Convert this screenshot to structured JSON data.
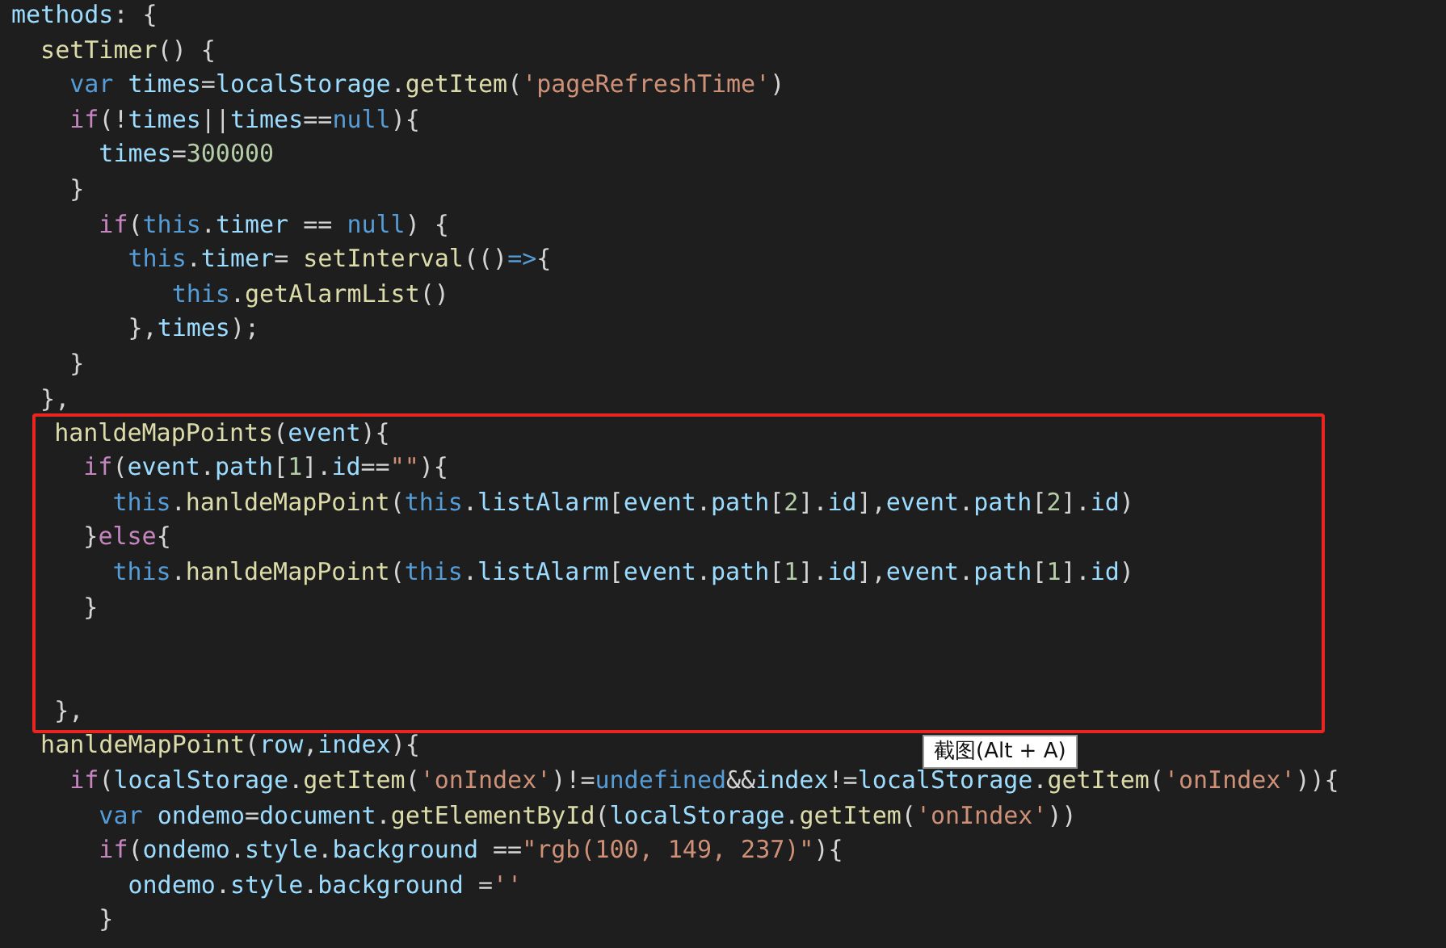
{
  "editor": {
    "sections": [
      {
        "boxed": false,
        "lines": [
          {
            "tokens": [
              {
                "text": "methods",
                "kind": "variable"
              },
              {
                "text": ": {",
                "kind": "plain"
              }
            ]
          },
          {
            "tokens": [
              {
                "text": "  setTimer",
                "kind": "function"
              },
              {
                "text": "() {",
                "kind": "plain"
              }
            ]
          },
          {
            "tokens": [
              {
                "text": "    var ",
                "kind": "keyword"
              },
              {
                "text": "times",
                "kind": "variable"
              },
              {
                "text": "=",
                "kind": "plain"
              },
              {
                "text": "localStorage",
                "kind": "variable"
              },
              {
                "text": ".",
                "kind": "plain"
              },
              {
                "text": "getItem",
                "kind": "function"
              },
              {
                "text": "(",
                "kind": "plain"
              },
              {
                "text": "'pageRefreshTime'",
                "kind": "string"
              },
              {
                "text": ")",
                "kind": "plain"
              }
            ]
          },
          {
            "tokens": [
              {
                "text": "    if",
                "kind": "control"
              },
              {
                "text": "(!",
                "kind": "plain"
              },
              {
                "text": "times",
                "kind": "variable"
              },
              {
                "text": "||",
                "kind": "plain"
              },
              {
                "text": "times",
                "kind": "variable"
              },
              {
                "text": "==",
                "kind": "plain"
              },
              {
                "text": "null",
                "kind": "keyword"
              },
              {
                "text": "){",
                "kind": "plain"
              }
            ]
          },
          {
            "tokens": [
              {
                "text": "      times",
                "kind": "variable"
              },
              {
                "text": "=",
                "kind": "plain"
              },
              {
                "text": "300000",
                "kind": "number"
              }
            ]
          },
          {
            "tokens": [
              {
                "text": "    }",
                "kind": "plain"
              }
            ]
          },
          {
            "tokens": [
              {
                "text": "      if",
                "kind": "control"
              },
              {
                "text": "(",
                "kind": "plain"
              },
              {
                "text": "this",
                "kind": "keyword"
              },
              {
                "text": ".",
                "kind": "plain"
              },
              {
                "text": "timer",
                "kind": "variable"
              },
              {
                "text": " == ",
                "kind": "plain"
              },
              {
                "text": "null",
                "kind": "keyword"
              },
              {
                "text": ") {",
                "kind": "plain"
              }
            ]
          },
          {
            "tokens": [
              {
                "text": "        this",
                "kind": "keyword"
              },
              {
                "text": ".",
                "kind": "plain"
              },
              {
                "text": "timer",
                "kind": "variable"
              },
              {
                "text": "= ",
                "kind": "plain"
              },
              {
                "text": "setInterval",
                "kind": "function"
              },
              {
                "text": "(()",
                "kind": "plain"
              },
              {
                "text": "=>",
                "kind": "keyword"
              },
              {
                "text": "{",
                "kind": "plain"
              }
            ]
          },
          {
            "tokens": [
              {
                "text": "           this",
                "kind": "keyword"
              },
              {
                "text": ".",
                "kind": "plain"
              },
              {
                "text": "getAlarmList",
                "kind": "function"
              },
              {
                "text": "()",
                "kind": "plain"
              }
            ]
          },
          {
            "tokens": [
              {
                "text": "        },",
                "kind": "plain"
              },
              {
                "text": "times",
                "kind": "variable"
              },
              {
                "text": ");",
                "kind": "plain"
              }
            ]
          },
          {
            "tokens": [
              {
                "text": "    }",
                "kind": "plain"
              }
            ]
          },
          {
            "tokens": [
              {
                "text": "  },",
                "kind": "plain"
              }
            ]
          }
        ]
      },
      {
        "boxed": true,
        "lines": [
          {
            "tokens": [
              {
                "text": "   hanldeMapPoints",
                "kind": "function"
              },
              {
                "text": "(",
                "kind": "plain"
              },
              {
                "text": "event",
                "kind": "variable"
              },
              {
                "text": "){",
                "kind": "plain"
              }
            ]
          },
          {
            "tokens": [
              {
                "text": "     if",
                "kind": "control"
              },
              {
                "text": "(",
                "kind": "plain"
              },
              {
                "text": "event",
                "kind": "variable"
              },
              {
                "text": ".",
                "kind": "plain"
              },
              {
                "text": "path",
                "kind": "variable"
              },
              {
                "text": "[",
                "kind": "plain"
              },
              {
                "text": "1",
                "kind": "number"
              },
              {
                "text": "].",
                "kind": "plain"
              },
              {
                "text": "id",
                "kind": "variable"
              },
              {
                "text": "==",
                "kind": "plain"
              },
              {
                "text": "\"\"",
                "kind": "string"
              },
              {
                "text": "){",
                "kind": "plain"
              }
            ]
          },
          {
            "tokens": [
              {
                "text": "       this",
                "kind": "keyword"
              },
              {
                "text": ".",
                "kind": "plain"
              },
              {
                "text": "hanldeMapPoint",
                "kind": "function"
              },
              {
                "text": "(",
                "kind": "plain"
              },
              {
                "text": "this",
                "kind": "keyword"
              },
              {
                "text": ".",
                "kind": "plain"
              },
              {
                "text": "listAlarm",
                "kind": "variable"
              },
              {
                "text": "[",
                "kind": "plain"
              },
              {
                "text": "event",
                "kind": "variable"
              },
              {
                "text": ".",
                "kind": "plain"
              },
              {
                "text": "path",
                "kind": "variable"
              },
              {
                "text": "[",
                "kind": "plain"
              },
              {
                "text": "2",
                "kind": "number"
              },
              {
                "text": "].",
                "kind": "plain"
              },
              {
                "text": "id",
                "kind": "variable"
              },
              {
                "text": "],",
                "kind": "plain"
              },
              {
                "text": "event",
                "kind": "variable"
              },
              {
                "text": ".",
                "kind": "plain"
              },
              {
                "text": "path",
                "kind": "variable"
              },
              {
                "text": "[",
                "kind": "plain"
              },
              {
                "text": "2",
                "kind": "number"
              },
              {
                "text": "].",
                "kind": "plain"
              },
              {
                "text": "id",
                "kind": "variable"
              },
              {
                "text": ")",
                "kind": "plain"
              }
            ]
          },
          {
            "tokens": [
              {
                "text": "     }",
                "kind": "plain"
              },
              {
                "text": "else",
                "kind": "control"
              },
              {
                "text": "{",
                "kind": "plain"
              }
            ]
          },
          {
            "tokens": [
              {
                "text": "       this",
                "kind": "keyword"
              },
              {
                "text": ".",
                "kind": "plain"
              },
              {
                "text": "hanldeMapPoint",
                "kind": "function"
              },
              {
                "text": "(",
                "kind": "plain"
              },
              {
                "text": "this",
                "kind": "keyword"
              },
              {
                "text": ".",
                "kind": "plain"
              },
              {
                "text": "listAlarm",
                "kind": "variable"
              },
              {
                "text": "[",
                "kind": "plain"
              },
              {
                "text": "event",
                "kind": "variable"
              },
              {
                "text": ".",
                "kind": "plain"
              },
              {
                "text": "path",
                "kind": "variable"
              },
              {
                "text": "[",
                "kind": "plain"
              },
              {
                "text": "1",
                "kind": "number"
              },
              {
                "text": "].",
                "kind": "plain"
              },
              {
                "text": "id",
                "kind": "variable"
              },
              {
                "text": "],",
                "kind": "plain"
              },
              {
                "text": "event",
                "kind": "variable"
              },
              {
                "text": ".",
                "kind": "plain"
              },
              {
                "text": "path",
                "kind": "variable"
              },
              {
                "text": "[",
                "kind": "plain"
              },
              {
                "text": "1",
                "kind": "number"
              },
              {
                "text": "].",
                "kind": "plain"
              },
              {
                "text": "id",
                "kind": "variable"
              },
              {
                "text": ")",
                "kind": "plain"
              }
            ]
          },
          {
            "tokens": [
              {
                "text": "     }",
                "kind": "plain"
              }
            ]
          },
          {
            "blank": true
          },
          {
            "blank": true
          },
          {
            "tokens": [
              {
                "text": "   },",
                "kind": "plain"
              }
            ]
          }
        ]
      },
      {
        "boxed": false,
        "lines": [
          {
            "tokens": [
              {
                "text": "  hanldeMapPoint",
                "kind": "function"
              },
              {
                "text": "(",
                "kind": "plain"
              },
              {
                "text": "row",
                "kind": "variable"
              },
              {
                "text": ",",
                "kind": "plain"
              },
              {
                "text": "index",
                "kind": "variable"
              },
              {
                "text": "){",
                "kind": "plain"
              }
            ]
          },
          {
            "tokens": [
              {
                "text": "    if",
                "kind": "control"
              },
              {
                "text": "(",
                "kind": "plain"
              },
              {
                "text": "localStorage",
                "kind": "variable"
              },
              {
                "text": ".",
                "kind": "plain"
              },
              {
                "text": "getItem",
                "kind": "function"
              },
              {
                "text": "(",
                "kind": "plain"
              },
              {
                "text": "'onIndex'",
                "kind": "string"
              },
              {
                "text": ")!=",
                "kind": "plain"
              },
              {
                "text": "undefined",
                "kind": "keyword"
              },
              {
                "text": "&&",
                "kind": "plain"
              },
              {
                "text": "index",
                "kind": "variable"
              },
              {
                "text": "!=",
                "kind": "plain"
              },
              {
                "text": "localStorage",
                "kind": "variable"
              },
              {
                "text": ".",
                "kind": "plain"
              },
              {
                "text": "getItem",
                "kind": "function"
              },
              {
                "text": "(",
                "kind": "plain"
              },
              {
                "text": "'onIndex'",
                "kind": "string"
              },
              {
                "text": ")){",
                "kind": "plain"
              }
            ]
          },
          {
            "tokens": [
              {
                "text": "      var ",
                "kind": "keyword"
              },
              {
                "text": "ondemo",
                "kind": "variable"
              },
              {
                "text": "=",
                "kind": "plain"
              },
              {
                "text": "document",
                "kind": "variable"
              },
              {
                "text": ".",
                "kind": "plain"
              },
              {
                "text": "getElementById",
                "kind": "function"
              },
              {
                "text": "(",
                "kind": "plain"
              },
              {
                "text": "localStorage",
                "kind": "variable"
              },
              {
                "text": ".",
                "kind": "plain"
              },
              {
                "text": "getItem",
                "kind": "function"
              },
              {
                "text": "(",
                "kind": "plain"
              },
              {
                "text": "'onIndex'",
                "kind": "string"
              },
              {
                "text": "))",
                "kind": "plain"
              }
            ]
          },
          {
            "tokens": [
              {
                "text": "      if",
                "kind": "control"
              },
              {
                "text": "(",
                "kind": "plain"
              },
              {
                "text": "ondemo",
                "kind": "variable"
              },
              {
                "text": ".",
                "kind": "plain"
              },
              {
                "text": "style",
                "kind": "variable"
              },
              {
                "text": ".",
                "kind": "plain"
              },
              {
                "text": "background",
                "kind": "variable"
              },
              {
                "text": " ==",
                "kind": "plain"
              },
              {
                "text": "\"rgb(100, 149, 237)\"",
                "kind": "string"
              },
              {
                "text": "){",
                "kind": "plain"
              }
            ]
          },
          {
            "tokens": [
              {
                "text": "        ondemo",
                "kind": "variable"
              },
              {
                "text": ".",
                "kind": "plain"
              },
              {
                "text": "style",
                "kind": "variable"
              },
              {
                "text": ".",
                "kind": "plain"
              },
              {
                "text": "background",
                "kind": "variable"
              },
              {
                "text": " =",
                "kind": "plain"
              },
              {
                "text": "''",
                "kind": "string"
              }
            ]
          },
          {
            "tokens": [
              {
                "text": "      }",
                "kind": "plain"
              }
            ]
          }
        ]
      }
    ]
  },
  "tooltip": {
    "text": "截图(Alt + A)"
  }
}
